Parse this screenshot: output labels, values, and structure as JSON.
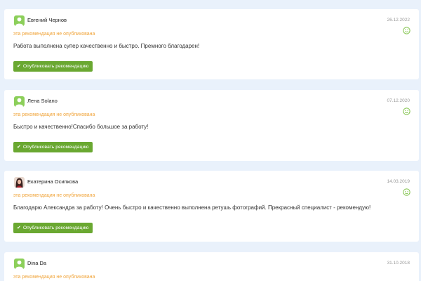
{
  "colors": {
    "page_bg": "#e9f1fb",
    "card_bg": "#ffffff",
    "status_orange": "#f0a43a",
    "button_green": "#6aa831",
    "smile_green": "#7cc144"
  },
  "reviews": [
    {
      "author": "Евгений Чернов",
      "date": "26.12.2022",
      "status": "эта рекомендация не опубликована",
      "text": "Работа выполнена супер качественно и быстро. Премного благодарен!",
      "publish_label": "Опубликовать рекомендацию",
      "avatar_icon": "default-user-avatar",
      "rating_icon": "smile-icon"
    },
    {
      "author": "Лена Solano",
      "date": "07.12.2020",
      "status": "эта рекомендация не опубликована",
      "text": "Быстро и качественно!Спасибо большое за работу!",
      "publish_label": "Опубликовать рекомендацию",
      "avatar_icon": "default-user-avatar",
      "rating_icon": "smile-icon"
    },
    {
      "author": "Екатерина Осипкова",
      "date": "14.03.2019",
      "status": "эта рекомендация не опубликована",
      "text": "Благодарю Александра за работу! Очень быстро и качественно выполнена ретушь фотографий. Прекрасный специалист - рекомендую!",
      "publish_label": "Опубликовать рекомендацию",
      "avatar_icon": "photo-avatar",
      "rating_icon": "smile-icon"
    },
    {
      "author": "Dina Da",
      "date": "31.10.2018",
      "status": "эта рекомендация не опубликована",
      "avatar_icon": "default-user-avatar"
    }
  ]
}
